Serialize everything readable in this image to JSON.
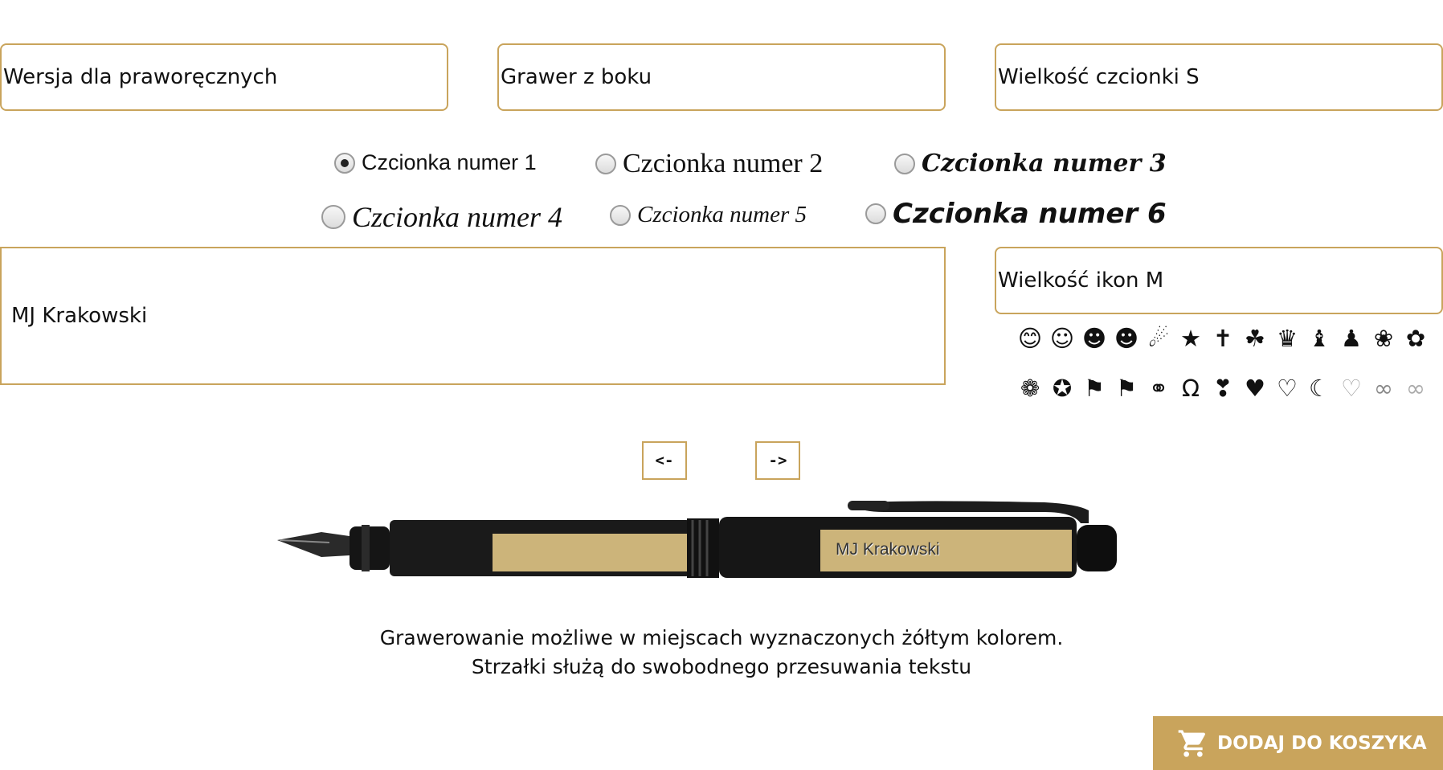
{
  "selects": {
    "hand": "Wersja dla praworęcznych",
    "position": "Grawer z boku",
    "font_size": "Wielkość czcionki S",
    "icon_size": "Wielkość ikon M"
  },
  "fonts": [
    {
      "label": "Czcionka numer 1",
      "checked": true
    },
    {
      "label": "Czcionka numer 2",
      "checked": false
    },
    {
      "label": "Czcionka numer 3",
      "checked": false
    },
    {
      "label": "Czcionka numer 4",
      "checked": false
    },
    {
      "label": "Czcionka numer 5",
      "checked": false
    },
    {
      "label": "Czcionka numer 6",
      "checked": false
    }
  ],
  "engraving_text": "MJ Krakowski",
  "icons": {
    "row1": [
      "😊",
      "☺",
      "☻",
      "☻",
      "☄",
      "★",
      "✝",
      "☘",
      "♛",
      "♝",
      "♟",
      "❀",
      "✿"
    ],
    "row2": [
      "❁",
      "✪",
      "⚑",
      "⚑",
      "⚭",
      "Ω",
      "❣",
      "♥",
      "♡",
      "☾",
      "♡",
      "∞",
      "∞"
    ]
  },
  "arrows": {
    "left": "<-",
    "right": "->"
  },
  "preview_text": "MJ Krakowski",
  "caption": {
    "line1": "Grawerowanie możliwe w miejscach wyznaczonych żółtym kolorem.",
    "line2": "Strzałki służą do swobodnego przesuwania tekstu"
  },
  "cart_button": "DODAJ DO KOSZYKA",
  "colors": {
    "accent": "#c9a45c",
    "engrave_area": "#ccb47a",
    "pen": "#1a1a1a"
  }
}
